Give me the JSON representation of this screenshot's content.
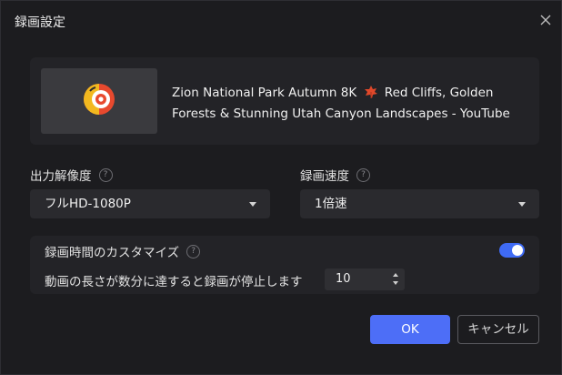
{
  "dialog": {
    "title": "録画設定",
    "close_icon": "close-icon"
  },
  "video": {
    "title": "Zion National Park Autumn 8K",
    "title_rest": "Red Cliffs, Golden Forests & Stunning Utah Canyon Landscapes - YouTube",
    "thumbnail_icon": "recorder-logo-icon",
    "emoji_icon": "maple-leaf-icon"
  },
  "resolution": {
    "label": "出力解像度",
    "help_icon": "question-icon",
    "help_glyph": "?",
    "selected": "フルHD-1080P"
  },
  "speed": {
    "label": "録画速度",
    "help_icon": "question-icon",
    "help_glyph": "?",
    "selected": "1倍速"
  },
  "custom_time": {
    "toggle_label": "録画時間のカスタマイズ",
    "help_icon": "question-icon",
    "help_glyph": "?",
    "enabled": true,
    "stop_label": "動画の長さが数分に達すると録画が停止します",
    "minutes": "10"
  },
  "buttons": {
    "ok": "OK",
    "cancel": "キャンセル"
  },
  "colors": {
    "accent": "#4d6ef7",
    "background": "#1c1c1f",
    "panel": "#232327"
  }
}
